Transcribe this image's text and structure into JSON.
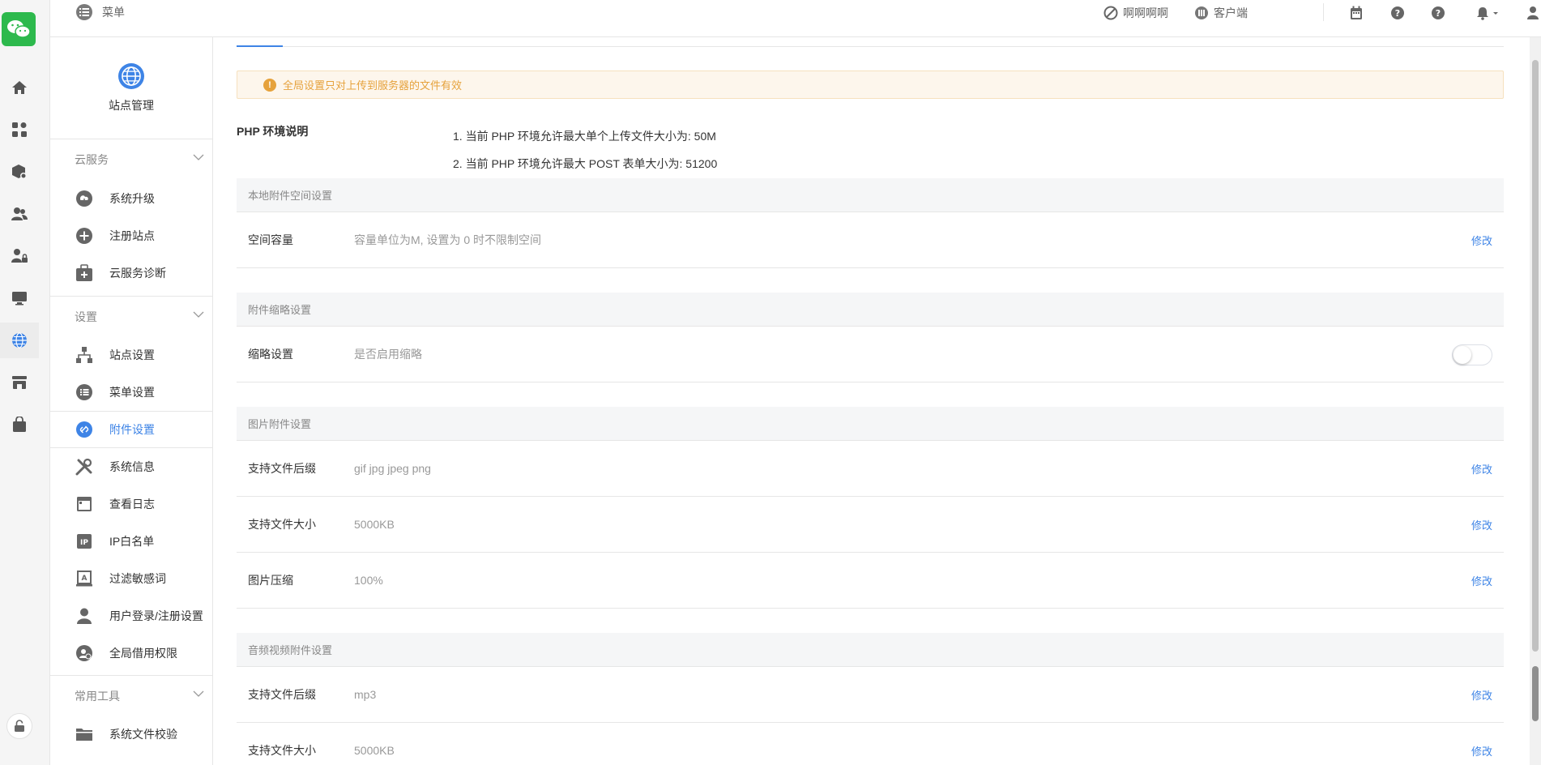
{
  "topbar": {
    "menu_label": "菜单",
    "account_label": "啊啊啊啊",
    "client_label": "客户端"
  },
  "site_head": {
    "label": "站点管理"
  },
  "sidebar": {
    "groups": [
      {
        "label": "云服务",
        "items": [
          {
            "label": "系统升级"
          },
          {
            "label": "注册站点"
          },
          {
            "label": "云服务诊断"
          }
        ]
      },
      {
        "label": "设置",
        "items": [
          {
            "label": "站点设置"
          },
          {
            "label": "菜单设置"
          },
          {
            "label": "附件设置"
          },
          {
            "label": "系统信息"
          },
          {
            "label": "查看日志"
          },
          {
            "label": "IP白名单"
          },
          {
            "label": "过滤敏感词"
          },
          {
            "label": "用户登录/注册设置"
          },
          {
            "label": "全局借用权限"
          }
        ]
      },
      {
        "label": "常用工具",
        "items": [
          {
            "label": "系统文件校验"
          }
        ]
      }
    ]
  },
  "alert": {
    "text": "全局设置只对上传到服务器的文件有效"
  },
  "php": {
    "title": "PHP 环境说明",
    "line1": "1. 当前 PHP 环境允许最大单个上传文件大小为: 50M",
    "line2": "2. 当前 PHP 环境允许最大 POST 表单大小为: 51200"
  },
  "sections": {
    "local": {
      "title": "本地附件空间设置",
      "rows": [
        {
          "label": "空间容量",
          "value": "容量单位为M, 设置为 0 时不限制空间",
          "action": "修改"
        }
      ]
    },
    "thumb": {
      "title": "附件缩略设置",
      "rows": [
        {
          "label": "缩略设置",
          "value": "是否启用缩略",
          "enabled": false
        }
      ]
    },
    "image": {
      "title": "图片附件设置",
      "rows": [
        {
          "label": "支持文件后缀",
          "value": "gif jpg jpeg png",
          "action": "修改"
        },
        {
          "label": "支持文件大小",
          "value": "5000KB",
          "action": "修改"
        },
        {
          "label": "图片压缩",
          "value": "100%",
          "action": "修改"
        }
      ]
    },
    "media": {
      "title": "音频视频附件设置",
      "rows": [
        {
          "label": "支持文件后缀",
          "value": "mp3",
          "action": "修改"
        },
        {
          "label": "支持文件大小",
          "value": "5000KB",
          "action": "修改"
        }
      ]
    }
  },
  "colors": {
    "accent": "#3e84e6",
    "warning": "#e6a23c",
    "brand": "#2db94d"
  }
}
